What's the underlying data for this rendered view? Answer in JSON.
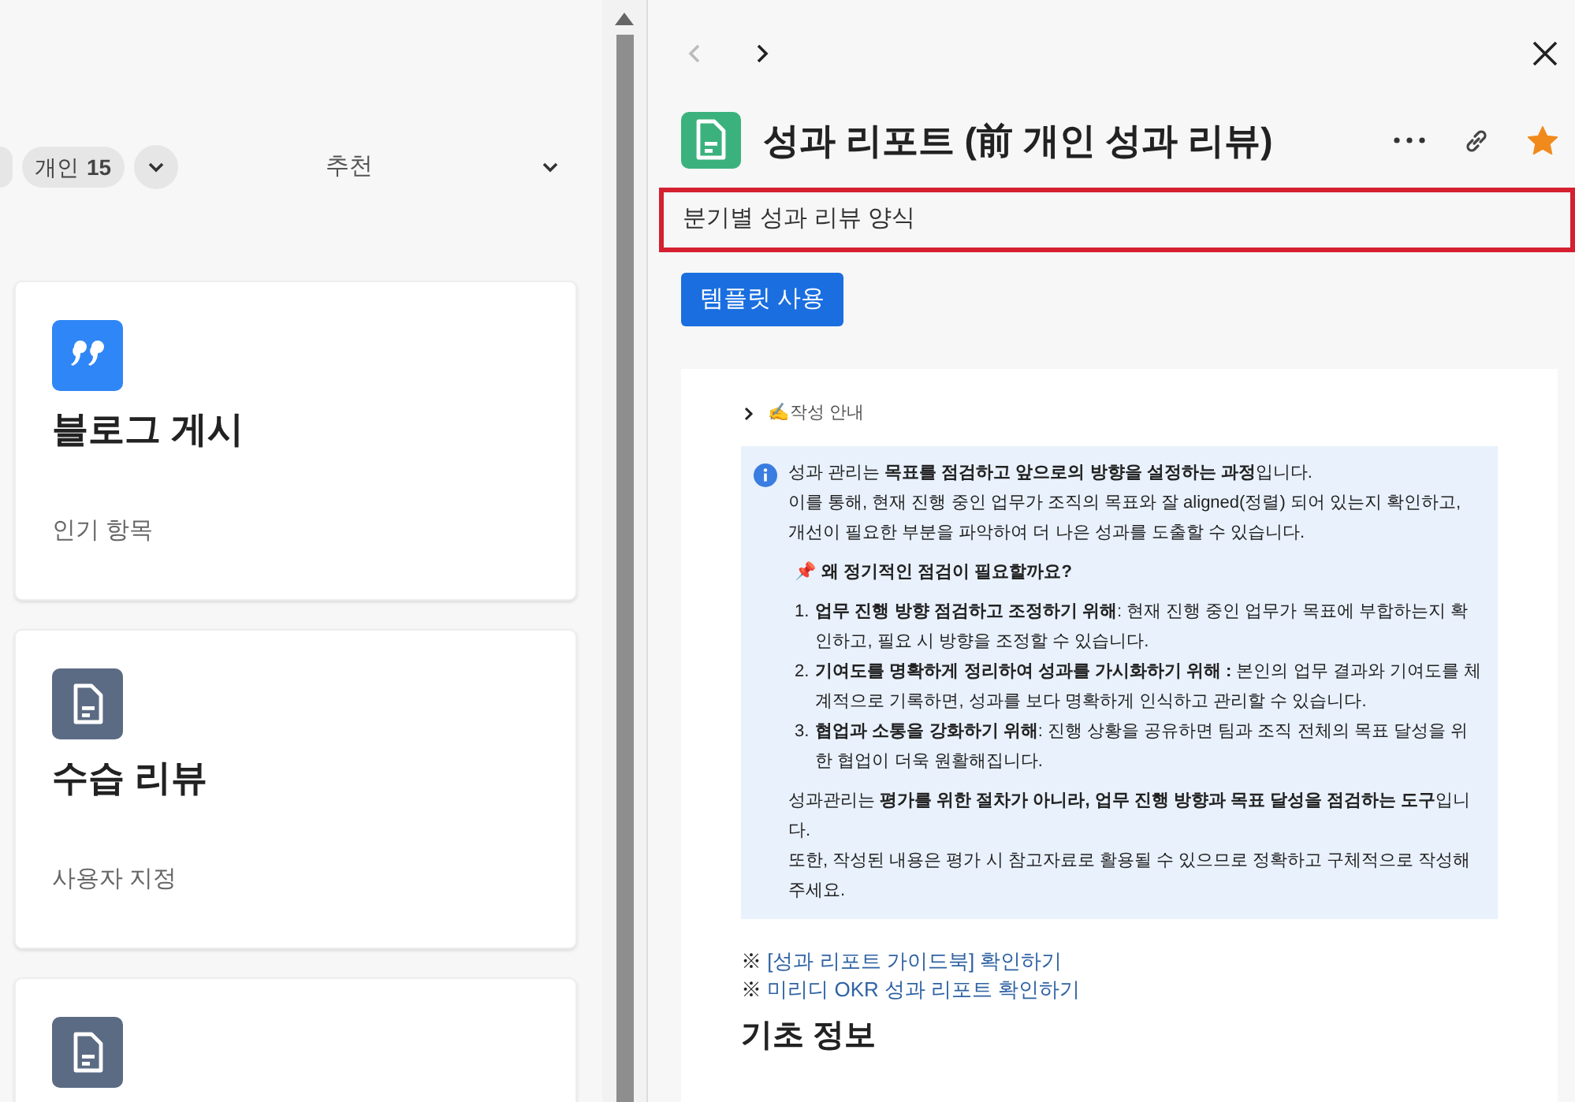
{
  "left_panel": {
    "filter_chips": [
      {
        "label": "개인",
        "count": "15"
      }
    ],
    "sort": {
      "label": "추천"
    },
    "cards": [
      {
        "kind": "quote",
        "title": "블로그 게시",
        "subtitle": "인기 항목"
      },
      {
        "kind": "document",
        "title": "수습 리뷰",
        "subtitle": "사용자 지정"
      },
      {
        "kind": "document"
      }
    ]
  },
  "detail": {
    "nav": {
      "back_disabled": true,
      "forward_disabled": false
    },
    "title": "성과 리포트 (前 개인 성과 리뷰)",
    "starred": true,
    "description": "분기별 성과 리뷰 양식",
    "primary_button": "템플릿 사용",
    "guide": {
      "toggle": {
        "label": "✍작성 안내",
        "expanded": false
      },
      "callout": {
        "paragraphs": [
          "성과 관리는 **목표를 점검하고 앞으로의 방향을 설정하는 과정**입니다.",
          "이를 통해, 현재 진행 중인 업무가 조직의 목표와 잘 aligned(정렬) 되어 있는지 확인하고, 개선이 필요한 부분을 파악하여 더 나은 성과를 도출할 수 있습니다."
        ],
        "heading": "📌 왜 정기적인 점검이 필요할까요?",
        "list_markers": [
          "1.",
          "2.",
          "3."
        ],
        "list": [
          "**업무 진행 방향 점검하고 조정하기 위해**: 현재 진행 중인 업무가 목표에 부합하는지 확인하고, 필요 시 방향을 조정할 수 있습니다.",
          "**기여도를 명확하게 정리하여 성과를 가시화하기 위해 :** 본인의 업무 결과와 기여도를 체계적으로 기록하면, 성과를 보다 명확하게 인식하고 관리할 수 있습니다.",
          "**협업과 소통을 강화하기 위해**: 진행 상황을 공유하면 팀과 조직 전체의 목표 달성을 위한 협업이 더욱 원활해집니다."
        ],
        "closing": [
          "성과관리는 **평가를 위한 절차가 아니라, 업무 진행 방향과 목표 달성을 점검하는 도구**입니다.",
          "또한, 작성된 내용은 평가 시 참고자료로 활용될 수 있으므로 정확하고 구체적으로 작성해 주세요."
        ]
      },
      "links": [
        {
          "marker": "※",
          "text": "[성과 리포트 가이드북] 확인하기"
        },
        {
          "marker": "※",
          "text": "미리디 OKR 성과 리포트 확인하기"
        }
      ],
      "section_heading": "기초 정보"
    }
  }
}
